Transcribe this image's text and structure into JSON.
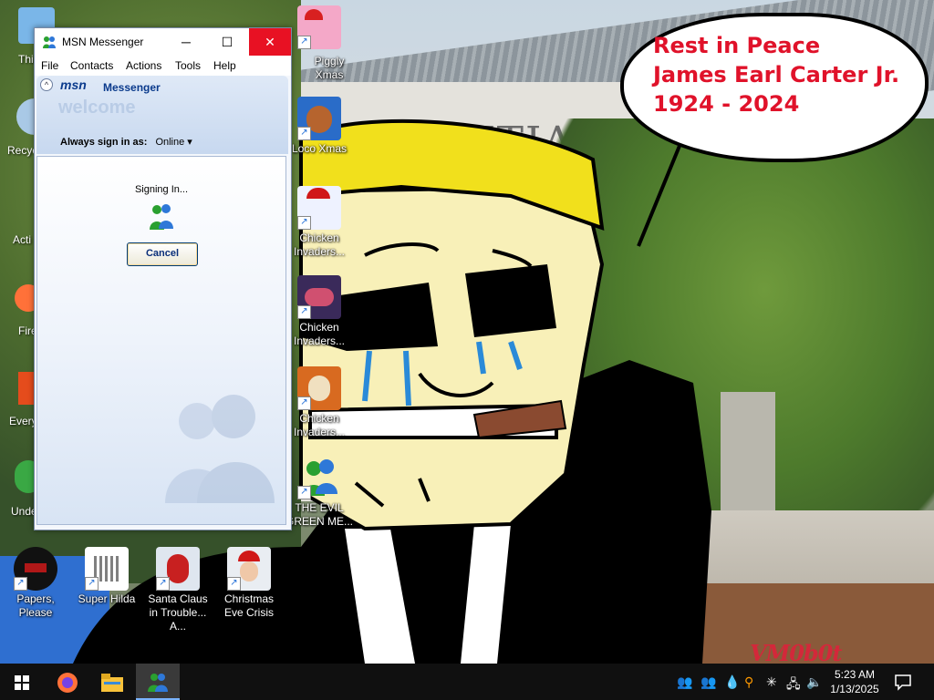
{
  "wallpaper": {
    "bubble_lines": [
      "Rest in Peace",
      "James Earl Carter Jr.",
      "1924 - 2024"
    ],
    "watermark": "VM0b0t",
    "building_text": "ENTIAL"
  },
  "desktop_icons": [
    {
      "label": "Piggly Xmas",
      "icon": "pig-santa-icon"
    },
    {
      "label": "Loco Xmas",
      "icon": "bear-santa-icon"
    },
    {
      "label": "Chicken Invaders...",
      "icon": "chicken-santa-icon"
    },
    {
      "label": "Chicken Invaders...",
      "icon": "chicken-spaceship-icon"
    },
    {
      "label": "Chicken Invaders...",
      "icon": "chicken-turkey-icon"
    },
    {
      "label": "THE EVIL GREEN ME...",
      "icon": "msn-buddy-icon"
    },
    {
      "label": "Papers, Please",
      "icon": "papers-please-icon"
    },
    {
      "label": "Super Hilda",
      "icon": "hilda-icon"
    },
    {
      "label": "Santa Claus in Trouble... A...",
      "icon": "santa-trouble-icon"
    },
    {
      "label": "Christmas Eve Crisis",
      "icon": "christmas-crisis-icon"
    }
  ],
  "partial_icons": [
    "This",
    "Recyc",
    "Acti",
    "Fire",
    "Every",
    "Unde"
  ],
  "msn": {
    "window_title": "MSN Messenger",
    "menu": [
      "File",
      "Contacts",
      "Actions",
      "Tools",
      "Help"
    ],
    "logo": "msn",
    "logo_word": "Messenger",
    "welcome": "welcome",
    "signin_label": "Always sign in as:",
    "signin_status": "Online",
    "status_text": "Signing In...",
    "cancel_label": "Cancel"
  },
  "taskbar": {
    "apps": [
      "start-icon",
      "firefox-icon",
      "file-explorer-icon",
      "msn-messenger-icon"
    ],
    "time": "5:23 AM",
    "date": "1/13/2025"
  }
}
